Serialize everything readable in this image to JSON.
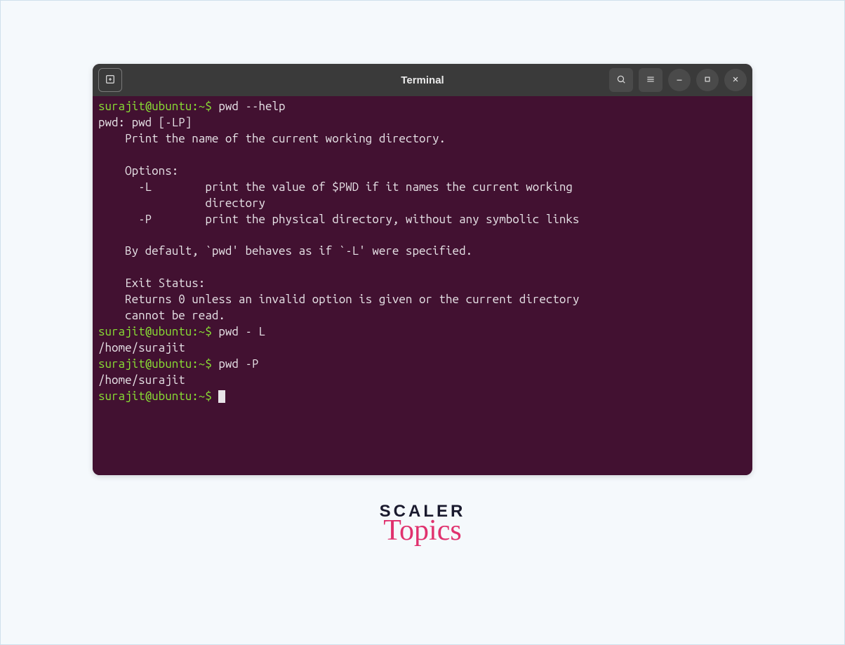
{
  "window": {
    "title": "Terminal"
  },
  "terminal": {
    "lines": [
      {
        "type": "prompt-cmd",
        "prompt": "surajit@ubuntu:~$",
        "cmd": " pwd --help"
      },
      {
        "type": "text",
        "text": "pwd: pwd [-LP]"
      },
      {
        "type": "text",
        "text": "    Print the name of the current working directory."
      },
      {
        "type": "text",
        "text": ""
      },
      {
        "type": "text",
        "text": "    Options:"
      },
      {
        "type": "text",
        "text": "      -L        print the value of $PWD if it names the current working"
      },
      {
        "type": "text",
        "text": "                directory"
      },
      {
        "type": "text",
        "text": "      -P        print the physical directory, without any symbolic links"
      },
      {
        "type": "text",
        "text": ""
      },
      {
        "type": "text",
        "text": "    By default, `pwd' behaves as if `-L' were specified."
      },
      {
        "type": "text",
        "text": ""
      },
      {
        "type": "text",
        "text": "    Exit Status:"
      },
      {
        "type": "text",
        "text": "    Returns 0 unless an invalid option is given or the current directory"
      },
      {
        "type": "text",
        "text": "    cannot be read."
      },
      {
        "type": "prompt-cmd",
        "prompt": "surajit@ubuntu:~$",
        "cmd": " pwd - L"
      },
      {
        "type": "text",
        "text": "/home/surajit"
      },
      {
        "type": "prompt-cmd",
        "prompt": "surajit@ubuntu:~$",
        "cmd": " pwd -P"
      },
      {
        "type": "text",
        "text": "/home/surajit"
      },
      {
        "type": "prompt-cursor",
        "prompt": "surajit@ubuntu:~$",
        "cmd": " "
      }
    ]
  },
  "logo": {
    "line1": "SCALER",
    "line2": "Topics"
  }
}
